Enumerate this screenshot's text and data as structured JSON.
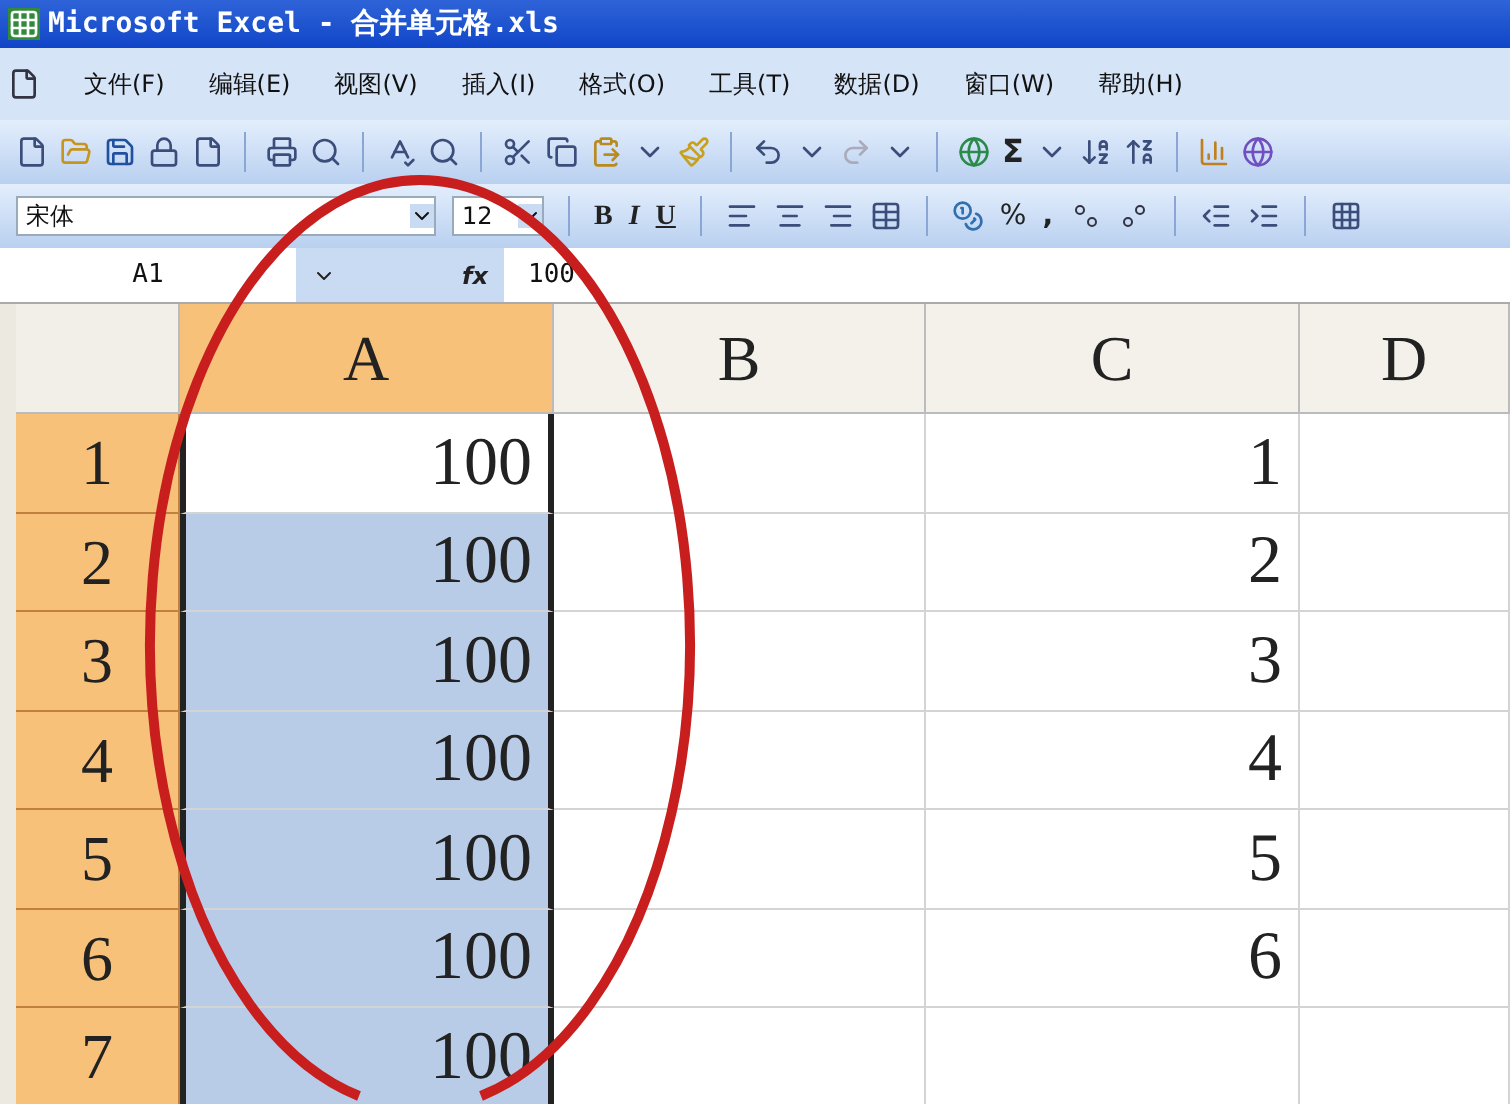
{
  "window": {
    "title": "Microsoft Excel - 合并单元格.xls"
  },
  "menu": [
    "文件(F)",
    "编辑(E)",
    "视图(V)",
    "插入(I)",
    "格式(O)",
    "工具(T)",
    "数据(D)",
    "窗口(W)",
    "帮助(H)"
  ],
  "standard_toolbar": {
    "sum_label": "Σ"
  },
  "formatting_toolbar": {
    "font": "宋体",
    "size": "12",
    "bold": "B",
    "italic": "I",
    "underline": "U",
    "percent": "%",
    "comma": ","
  },
  "formula_bar": {
    "name_box": "A1",
    "function_label": "fx",
    "formula": "100"
  },
  "columns": [
    {
      "label": "A",
      "selected": true
    },
    {
      "label": "B",
      "selected": false
    },
    {
      "label": "C",
      "selected": false
    },
    {
      "label": "D",
      "selected": false
    }
  ],
  "rows": [
    {
      "label": "1",
      "selected": true,
      "a": {
        "value": "100",
        "selected": true,
        "active": true
      },
      "c": {
        "value": "1"
      }
    },
    {
      "label": "2",
      "selected": true,
      "a": {
        "value": "100",
        "selected": true,
        "active": false
      },
      "c": {
        "value": "2"
      }
    },
    {
      "label": "3",
      "selected": true,
      "a": {
        "value": "100",
        "selected": true,
        "active": false
      },
      "c": {
        "value": "3"
      }
    },
    {
      "label": "4",
      "selected": true,
      "a": {
        "value": "100",
        "selected": true,
        "active": false
      },
      "c": {
        "value": "4"
      }
    },
    {
      "label": "5",
      "selected": true,
      "a": {
        "value": "100",
        "selected": true,
        "active": false
      },
      "c": {
        "value": "5"
      }
    },
    {
      "label": "6",
      "selected": true,
      "a": {
        "value": "100",
        "selected": true,
        "active": false
      },
      "c": {
        "value": "6"
      }
    },
    {
      "label": "7",
      "selected": true,
      "a": {
        "value": "100",
        "selected": true,
        "active": false
      }
    }
  ],
  "annotation": {
    "kind": "ellipse",
    "color": "#c81e1e"
  }
}
